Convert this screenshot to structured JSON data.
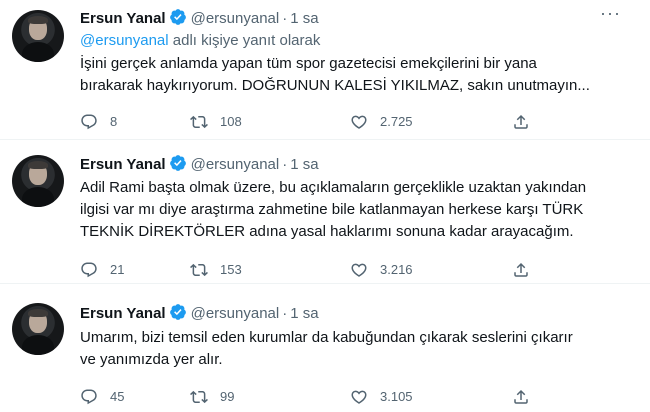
{
  "tweets": [
    {
      "author": "Ersun Yanal",
      "handle": "@ersunyanal",
      "separator": "·",
      "time": "1 sa",
      "reply_mention": "@ersunyanal",
      "reply_suffix": " adlı kişiye yanıt olarak",
      "text_lines": [
        "İşini gerçek anlamda yapan tüm spor gazetecisi emekçilerini bir yana",
        "bırakarak haykırıyorum. DOĞRUNUN KALESİ YIKILMAZ, sakın unutmayın..."
      ],
      "replies": "8",
      "retweets": "108",
      "likes": "2.725"
    },
    {
      "author": "Ersun Yanal",
      "handle": "@ersunyanal",
      "separator": "·",
      "time": "1 sa",
      "text_lines": [
        "Adil Rami başta olmak üzere, bu açıklamaların gerçeklikle uzaktan yakından",
        "ilgisi var mı diye araştırma zahmetine bile katlanmayan herkese karşı TÜRK",
        "TEKNİK DİREKTÖRLER adına yasal haklarımı sonuna kadar arayacağım."
      ],
      "replies": "21",
      "retweets": "153",
      "likes": "3.216"
    },
    {
      "author": "Ersun Yanal",
      "handle": "@ersunyanal",
      "separator": "·",
      "time": "1 sa",
      "text_lines": [
        "Umarım, bizi temsil eden kurumlar da kabuğundan çıkarak seslerini çıkarır",
        "ve yanımızda yer alır."
      ],
      "replies": "45",
      "retweets": "99",
      "likes": "3.105"
    }
  ],
  "colors": {
    "verified": "#1d9bf0",
    "mention": "#1d9bf0",
    "secondary_text": "#536471",
    "divider": "#eff3f4"
  },
  "icons": [
    "verified-badge-icon",
    "more-icon",
    "reply-icon",
    "retweet-icon",
    "like-icon",
    "share-icon"
  ]
}
